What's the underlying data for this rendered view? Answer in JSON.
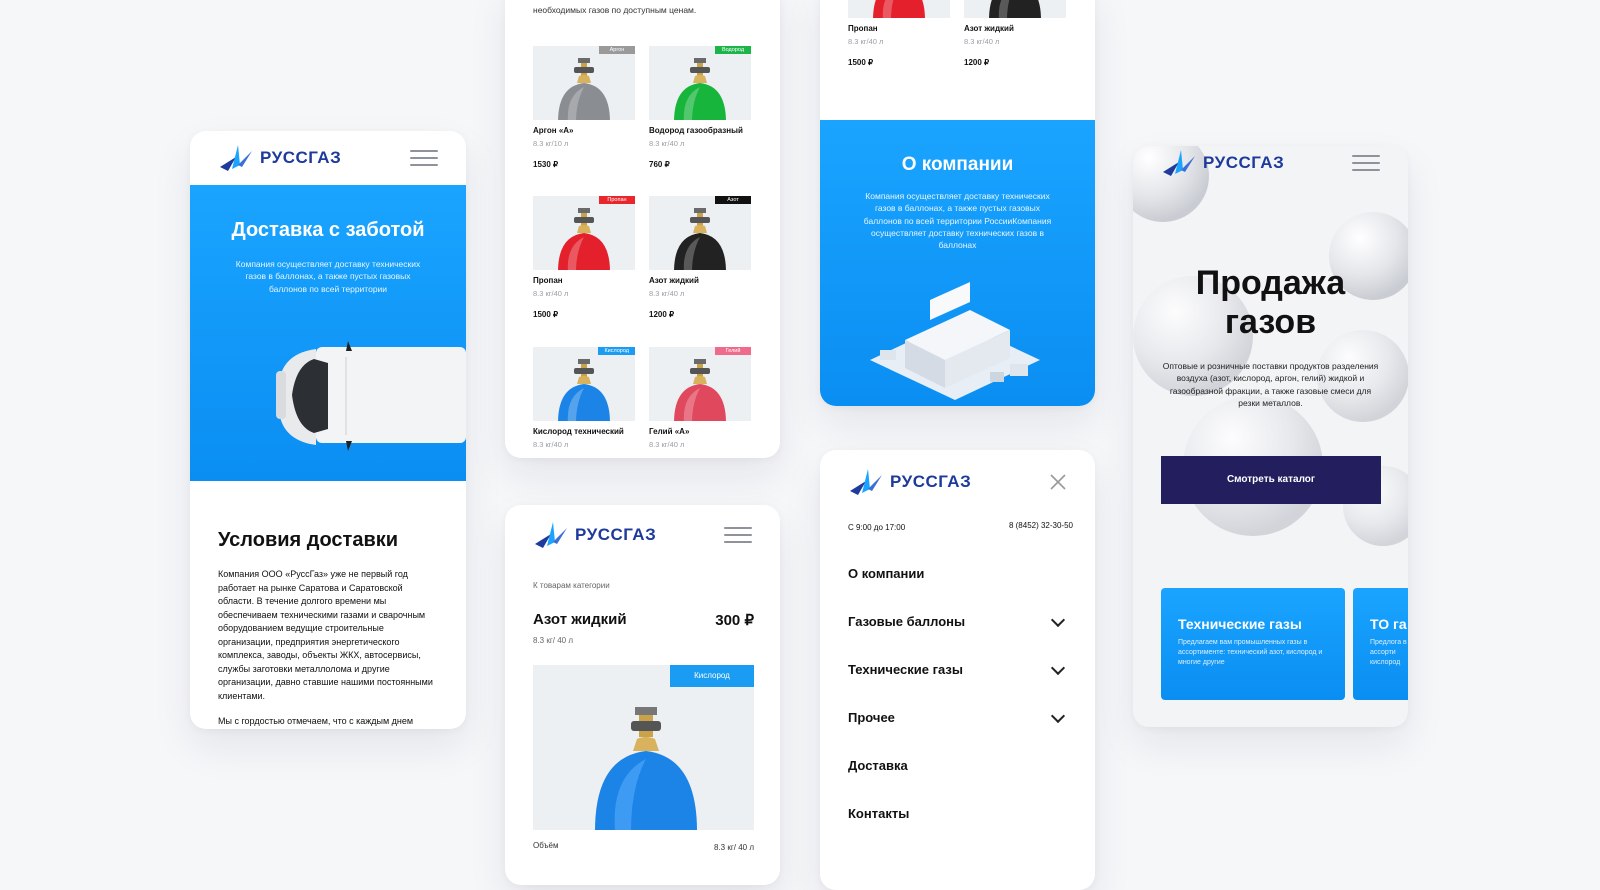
{
  "brand": {
    "name": "РУССГАЗ"
  },
  "colors": {
    "accent": "#0a8ef2",
    "brand": "#1d3a9c",
    "dark_button": "#231f5f"
  },
  "screen1": {
    "hero_title": "Доставка с заботой",
    "hero_text": "Компания осуществляет доставку технических газов в баллонах, а также пустых газовых баллонов по всей территории",
    "section_title": "Условия доставки",
    "para1": "Компания ООО «РуссГаз» уже не первый год работает на рынке Саратова и Саратовской области. В течение долгого времени мы обеспечиваем техническими газами и сварочным оборудованием ведущие строительные организации, предприятия энергетического комплекса, заводы, объекты ЖКХ, автосервисы, службы заготовки металлолома и другие организации, давно ставшие нашими постоянными клиентами.",
    "para2": "Мы с гордостью отмечаем, что с каждым днем количество предприятий, выбирающих, в качестве постоянного технического газа и сварочного"
  },
  "screen2": {
    "top_text": "необходимых газов по доступным ценам.",
    "products": [
      {
        "name": "Аргон «А»",
        "spec": "8.3 кг/10 л",
        "price": "1530 ₽",
        "badge": "Аргон",
        "badge_color": "#9a9a9a",
        "color": "#8a8d92"
      },
      {
        "name": "Водород газообразный",
        "spec": "8.3 кг/40 л",
        "price": "760 ₽",
        "badge": "Водород",
        "badge_color": "#1db44a",
        "color": "#18b53d"
      },
      {
        "name": "Пропан",
        "spec": "8.3 кг/40 л",
        "price": "1500 ₽",
        "badge": "Пропан",
        "badge_color": "#e8262b",
        "color": "#e3202c"
      },
      {
        "name": "Азот жидкий",
        "spec": "8.3 кг/40 л",
        "price": "1200 ₽",
        "badge": "Азот",
        "badge_color": "#111111",
        "color": "#222222"
      },
      {
        "name": "Кислород технический",
        "spec": "8.3 кг/40 л",
        "price": "",
        "badge": "Кислород",
        "badge_color": "#1a9cf2",
        "color": "#1c84e6"
      },
      {
        "name": "Гелий «А»",
        "spec": "8.3 кг/40 л",
        "price": "",
        "badge": "Гелий",
        "badge_color": "#f06a8c",
        "color": "#e0485e"
      }
    ]
  },
  "screen3": {
    "back_link": "К товарам категории",
    "title": "Азот жидкий",
    "price": "300 ₽",
    "spec": "8.3 кг/ 40 л",
    "badge": "Кислород",
    "volume_label": "Объём",
    "volume_value": "8.3 кг/ 40 л"
  },
  "screen4": {
    "products": [
      {
        "name": "Пропан",
        "spec": "8.3 кг/40 л",
        "price": "1500 ₽"
      },
      {
        "name": "Азот жидкий",
        "spec": "8.3 кг/40 л",
        "price": "1200 ₽"
      }
    ],
    "about_title": "О компании",
    "about_text": "Компания осуществляет доставку технических газов в баллонах, а также пустых газовых баллонов по всей территории РоссииКомпания осуществляет доставку технических газов в баллонах"
  },
  "screen5": {
    "hours": "С 9:00 до 17:00",
    "phone": "8 (8452) 32-30-50",
    "menu": [
      "О компании",
      "Газовые баллоны",
      "Технические газы",
      "Прочее",
      "Доставка",
      "Контакты"
    ]
  },
  "screen6": {
    "title": "Продажа газов",
    "text": "Оптовые и розничные поставки продуктов разделения воздуха (азот, кислород, аргон, гелий) жидкой и газообразной фракции, а также газовые смеси для резки металлов.",
    "button": "Смотреть каталог",
    "card1_title": "Технические газы",
    "card1_text": "Предлагаем вам промышленных газы в ассортименте: технический азот, кислород и многие другие",
    "card2_title": "ТО га",
    "card2_text": "Предлога в ассорти кислород"
  }
}
